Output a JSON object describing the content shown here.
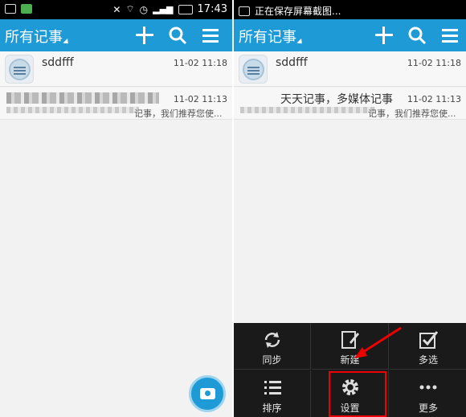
{
  "left": {
    "statusbar": {
      "time": "17:43"
    },
    "appbar": {
      "title": "所有记事"
    },
    "notes": [
      {
        "name": "sddfff",
        "time": "11-02 11:18"
      },
      {
        "name": "",
        "time": "11-02 11:13",
        "preview": "记事，我们推荐您使..."
      }
    ]
  },
  "right": {
    "statusbar": {
      "notice": "正在保存屏幕截图..."
    },
    "appbar": {
      "title": "所有记事"
    },
    "notes": [
      {
        "name": "sddfff",
        "time": "11-02 11:18"
      },
      {
        "name": "天天记事，多媒体记事",
        "time": "11-02 11:13",
        "preview": "记事，我们推荐您使..."
      }
    ],
    "menu": {
      "sync": "同步",
      "new": "新建",
      "multiselect": "多选",
      "sort": "排序",
      "settings": "设置",
      "more": "更多"
    }
  },
  "colors": {
    "accent": "#1e9bd6",
    "highlight": "#e00000"
  },
  "icons": [
    "add-icon",
    "search-icon",
    "menu-icon",
    "note-icon",
    "camera-icon",
    "sync-icon",
    "edit-icon",
    "checkbox-icon",
    "list-icon",
    "gear-icon",
    "more-icon"
  ]
}
